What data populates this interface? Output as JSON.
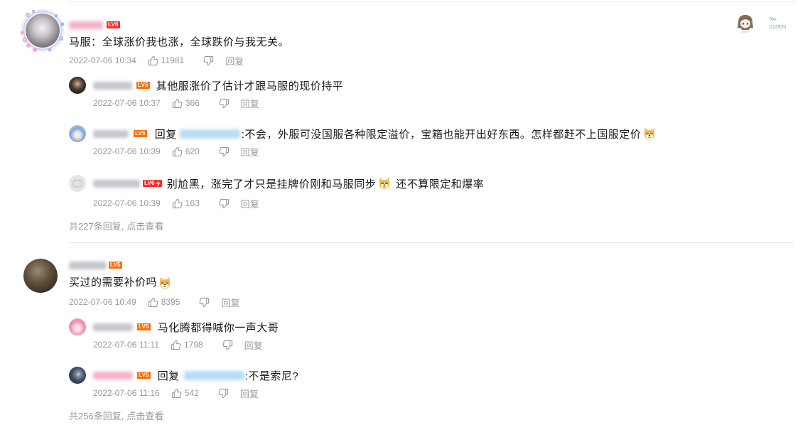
{
  "icons": {
    "like": "thumb-up-icon",
    "dislike": "thumb-down-icon",
    "emoji": "doge-emoji",
    "hardcore": "lightning-icon",
    "default_avatar": "tv-avatar-icon"
  },
  "colors": {
    "text": "#18191c",
    "meta": "#9499a0",
    "lv5": "#ff6c00",
    "lv6": "#ff2a2a",
    "divider": "#e3e5e7",
    "fan_number": "#6fa79c"
  },
  "comments": [
    {
      "level": "LV6",
      "text": "马服：全球涨价我也涨，全球跌价与我无关。",
      "date": "2022-07-06 10:34",
      "likes": "11981",
      "reply_label": "回复",
      "fan_card": {
        "no_label": "No.",
        "number": "012920"
      },
      "replies": [
        {
          "level": "LV5",
          "text": "其他服涨价了估计才跟马服的现价持平",
          "date": "2022-07-06 10:37",
          "likes": "366",
          "reply_label": "回复"
        },
        {
          "level": "LV5",
          "reply_prefix": "回复",
          "text": ":不会，外服可没国服各种限定溢价，宝箱也能开出好东西。怎样都赶不上国服定价",
          "emoji": "doge",
          "date": "2022-07-06 10:39",
          "likes": "620",
          "reply_label": "回复"
        },
        {
          "level": "LV6",
          "hardcore": true,
          "text": "别尬黑，涨完了才只是挂牌价刚和马服同步",
          "emoji": "doge",
          "text_after": "还不算限定和爆率",
          "date": "2022-07-06 10:39",
          "likes": "163",
          "reply_label": "回复"
        }
      ],
      "reply_summary": {
        "count": "共227条回复,",
        "link": "点击查看"
      }
    },
    {
      "level": "LV5",
      "text": "买过的需要补价吗",
      "emoji": "doge",
      "date": "2022-07-06 10:49",
      "likes": "8395",
      "reply_label": "回复",
      "replies": [
        {
          "level": "LV5",
          "text": "马化腾都得喊你一声大哥",
          "date": "2022-07-06 11:11",
          "likes": "1798",
          "reply_label": "回复"
        },
        {
          "level": "LV5",
          "reply_prefix": "回复",
          "text": ":不是索尼?",
          "date": "2022-07-06 11:16",
          "likes": "542",
          "reply_label": "回复"
        }
      ],
      "reply_summary": {
        "count": "共256条回复,",
        "link": "点击查看"
      }
    }
  ]
}
